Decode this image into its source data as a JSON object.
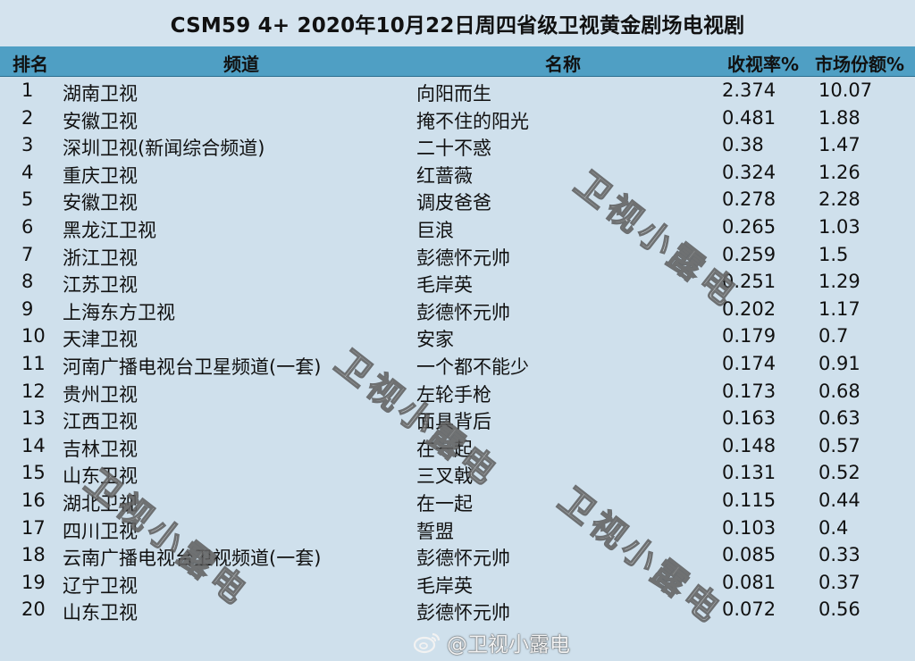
{
  "title": "CSM59 4+ 2020年10月22日周四省级卫视黄金剧场电视剧",
  "headers": {
    "rank": "排名",
    "channel": "频道",
    "name": "名称",
    "rating": "收视率%",
    "share": "市场份额%"
  },
  "rows": [
    {
      "rank": "1",
      "channel": "湖南卫视",
      "name": "向阳而生",
      "rating": "2.374",
      "share": "10.07"
    },
    {
      "rank": "2",
      "channel": "安徽卫视",
      "name": "掩不住的阳光",
      "rating": "0.481",
      "share": "1.88"
    },
    {
      "rank": "3",
      "channel": "深圳卫视(新闻综合频道)",
      "name": "二十不惑",
      "rating": "0.38",
      "share": "1.47"
    },
    {
      "rank": "4",
      "channel": "重庆卫视",
      "name": "红蔷薇",
      "rating": "0.324",
      "share": "1.26"
    },
    {
      "rank": "5",
      "channel": "安徽卫视",
      "name": "调皮爸爸",
      "rating": "0.278",
      "share": "2.28"
    },
    {
      "rank": "6",
      "channel": "黑龙江卫视",
      "name": "巨浪",
      "rating": "0.265",
      "share": "1.03"
    },
    {
      "rank": "7",
      "channel": "浙江卫视",
      "name": "彭德怀元帅",
      "rating": "0.259",
      "share": "1.5"
    },
    {
      "rank": "8",
      "channel": "江苏卫视",
      "name": "毛岸英",
      "rating": "0.251",
      "share": "1.29"
    },
    {
      "rank": "9",
      "channel": "上海东方卫视",
      "name": "彭德怀元帅",
      "rating": "0.202",
      "share": "1.17"
    },
    {
      "rank": "10",
      "channel": "天津卫视",
      "name": "安家",
      "rating": "0.179",
      "share": "0.7"
    },
    {
      "rank": "11",
      "channel": "河南广播电视台卫星频道(一套)",
      "name": "一个都不能少",
      "rating": "0.174",
      "share": "0.91"
    },
    {
      "rank": "12",
      "channel": "贵州卫视",
      "name": "左轮手枪",
      "rating": "0.173",
      "share": "0.68"
    },
    {
      "rank": "13",
      "channel": "江西卫视",
      "name": "面具背后",
      "rating": "0.163",
      "share": "0.63"
    },
    {
      "rank": "14",
      "channel": "吉林卫视",
      "name": "在一起",
      "rating": "0.148",
      "share": "0.57"
    },
    {
      "rank": "15",
      "channel": "山东卫视",
      "name": "三叉戟",
      "rating": "0.131",
      "share": "0.52"
    },
    {
      "rank": "16",
      "channel": "湖北卫视",
      "name": "在一起",
      "rating": "0.115",
      "share": "0.44"
    },
    {
      "rank": "17",
      "channel": "四川卫视",
      "name": "誓盟",
      "rating": "0.103",
      "share": "0.4"
    },
    {
      "rank": "18",
      "channel": "云南广播电视台卫视频道(一套)",
      "name": "彭德怀元帅",
      "rating": "0.085",
      "share": "0.33"
    },
    {
      "rank": "19",
      "channel": "辽宁卫视",
      "name": "毛岸英",
      "rating": "0.081",
      "share": "0.37"
    },
    {
      "rank": "20",
      "channel": "山东卫视",
      "name": "彭德怀元帅",
      "rating": "0.072",
      "share": "0.56"
    }
  ],
  "watermark": "卫视小露电",
  "weibo_handle": "@卫视小露电",
  "colors": {
    "background": "#cfe0ec",
    "header": "#4f9fc4"
  }
}
